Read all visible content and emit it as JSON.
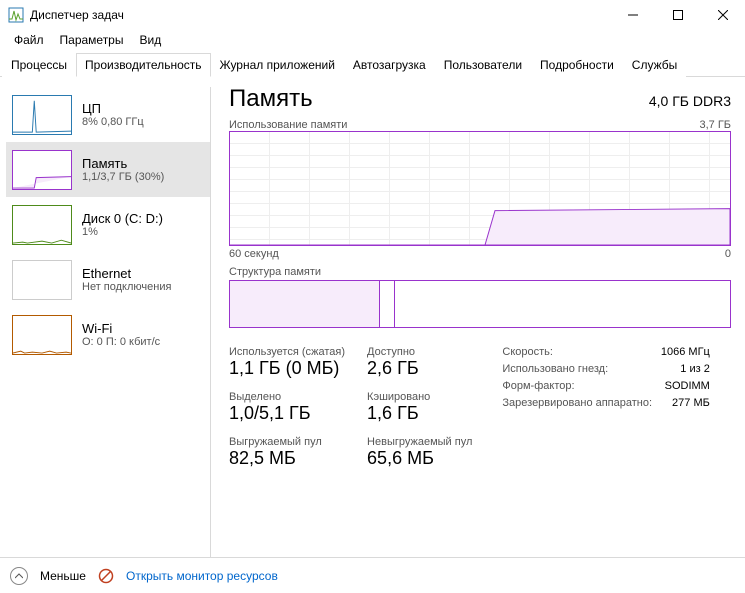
{
  "window": {
    "title": "Диспетчер задач"
  },
  "menu": {
    "file": "Файл",
    "options": "Параметры",
    "view": "Вид"
  },
  "tabs": {
    "processes": "Процессы",
    "performance": "Производительность",
    "apphistory": "Журнал приложений",
    "startup": "Автозагрузка",
    "users": "Пользователи",
    "details": "Подробности",
    "services": "Службы"
  },
  "sidebar": {
    "cpu": {
      "title": "ЦП",
      "sub": "8% 0,80 ГГц"
    },
    "memory": {
      "title": "Память",
      "sub": "1,1/3,7 ГБ (30%)"
    },
    "disk": {
      "title": "Диск 0 (C: D:)",
      "sub": "1%"
    },
    "eth": {
      "title": "Ethernet",
      "sub": "Нет подключения"
    },
    "wifi": {
      "title": "Wi-Fi",
      "sub": "О: 0 П: 0 кбит/с"
    }
  },
  "main": {
    "title": "Память",
    "subtitle": "4,0 ГБ DDR3",
    "usage_label": "Использование памяти",
    "usage_max": "3,7 ГБ",
    "xaxis_left": "60 секунд",
    "xaxis_right": "0",
    "comp_label": "Структура памяти"
  },
  "stats": {
    "inuse_label": "Используется (сжатая)",
    "inuse_val": "1,1 ГБ (0 МБ)",
    "avail_label": "Доступно",
    "avail_val": "2,6 ГБ",
    "committed_label": "Выделено",
    "committed_val": "1,0/5,1 ГБ",
    "cached_label": "Кэшировано",
    "cached_val": "1,6 ГБ",
    "paged_label": "Выгружаемый пул",
    "paged_val": "82,5 МБ",
    "nonpaged_label": "Невыгружаемый пул",
    "nonpaged_val": "65,6 МБ"
  },
  "spec": {
    "speed_l": "Скорость:",
    "speed_v": "1066 МГц",
    "slots_l": "Использовано гнезд:",
    "slots_v": "1 из 2",
    "form_l": "Форм-фактор:",
    "form_v": "SODIMM",
    "hw_l": "Зарезервировано аппаратно:",
    "hw_v": "277 МБ"
  },
  "footer": {
    "fewer": "Меньше",
    "monitor": "Открыть монитор ресурсов"
  },
  "chart_data": {
    "type": "area",
    "title": "Использование памяти",
    "ylabel": "ГБ",
    "ylim": [
      0,
      3.7
    ],
    "x_seconds": [
      60,
      55,
      50,
      45,
      40,
      35,
      30,
      25,
      20,
      15,
      10,
      5,
      0
    ],
    "values": [
      0,
      0,
      0,
      0,
      0,
      0,
      0,
      1.1,
      1.1,
      1.1,
      1.1,
      1.1,
      1.12
    ]
  }
}
